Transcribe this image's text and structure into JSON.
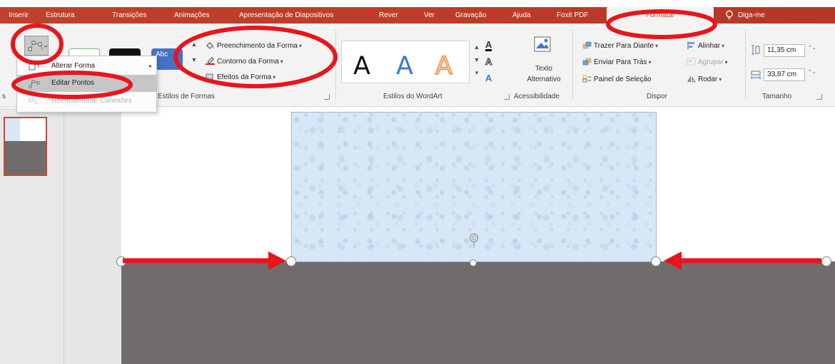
{
  "tabs": [
    {
      "label": "Inserir"
    },
    {
      "label": "Estrutura"
    },
    {
      "label": "Transições"
    },
    {
      "label": "Animações"
    },
    {
      "label": "Apresentação de Diapositivos"
    },
    {
      "label": "Rever"
    },
    {
      "label": "Ver"
    },
    {
      "label": "Gravação"
    },
    {
      "label": "Ajuda"
    },
    {
      "label": "Foxit PDF"
    },
    {
      "label": "Formatar"
    }
  ],
  "tell_me": "Diga-me",
  "ribbon": {
    "shape_styles": {
      "fill": "Preenchimento da Forma",
      "outline": "Contorno da Forma",
      "effects": "Efeitos da Forma",
      "sample_text": "Abc",
      "label": "Estilos de Formas"
    },
    "insert_shapes_label": "s",
    "wordart": {
      "letter": "A",
      "label": "Estilos do WordArt"
    },
    "accessibility": {
      "alt_text_line1": "Texto",
      "alt_text_line2": "Alternativo",
      "label": "Acessibilidade"
    },
    "arrange": {
      "bring_forward": "Trazer Para Diante",
      "send_backward": "Enviar Para Trás",
      "selection_pane": "Painel de Seleção",
      "align": "Alinhar",
      "group": "Agrupar",
      "rotate": "Rodar",
      "label": "Dispor"
    },
    "size": {
      "height": "11,35 cm",
      "width": "33,87 cm",
      "label": "Tamanho"
    }
  },
  "edit_shape_menu": {
    "items": [
      {
        "label": "Alterar Forma",
        "state": "normal"
      },
      {
        "label": "Editar Pontos",
        "state": "highlighted"
      },
      {
        "label": "Reencaminhar Conexões",
        "state": "disabled"
      }
    ]
  },
  "colors": {
    "accent": "#c1402a",
    "annotation_red": "#e8151c",
    "gray_shape": "#716c6c",
    "blue_shape": "#d8e7f5",
    "wordart_blue": "#3b7cd1",
    "wordart_orange": "#f4a15c"
  },
  "icons": {
    "edit_shape": "edit-shape-icon",
    "lightbulb": "lightbulb-icon",
    "rotate_handle": "rotate-handle-icon"
  }
}
